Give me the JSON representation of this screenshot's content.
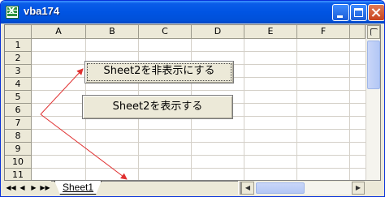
{
  "window": {
    "title": "vba174",
    "app_icon": "excel-icon"
  },
  "title_buttons": {
    "minimize": "minimize-icon",
    "maximize": "maximize-icon",
    "close": "close-icon"
  },
  "grid": {
    "columns": [
      "A",
      "B",
      "C",
      "D",
      "E",
      "F"
    ],
    "rows": [
      "1",
      "2",
      "3",
      "4",
      "5",
      "6",
      "7",
      "8",
      "9",
      "10",
      "11"
    ]
  },
  "buttons": {
    "hide": "Sheet2を非表示にする",
    "show": "Sheet2を表示する"
  },
  "annotation": {
    "arrow_color": "#e03030"
  },
  "tabs": {
    "nav": [
      "◀◀",
      "◀",
      "▶",
      "▶▶"
    ],
    "sheets": [
      "Sheet1"
    ],
    "active": "Sheet1"
  },
  "scrollbar": {
    "left": "◀",
    "right": "▶"
  }
}
